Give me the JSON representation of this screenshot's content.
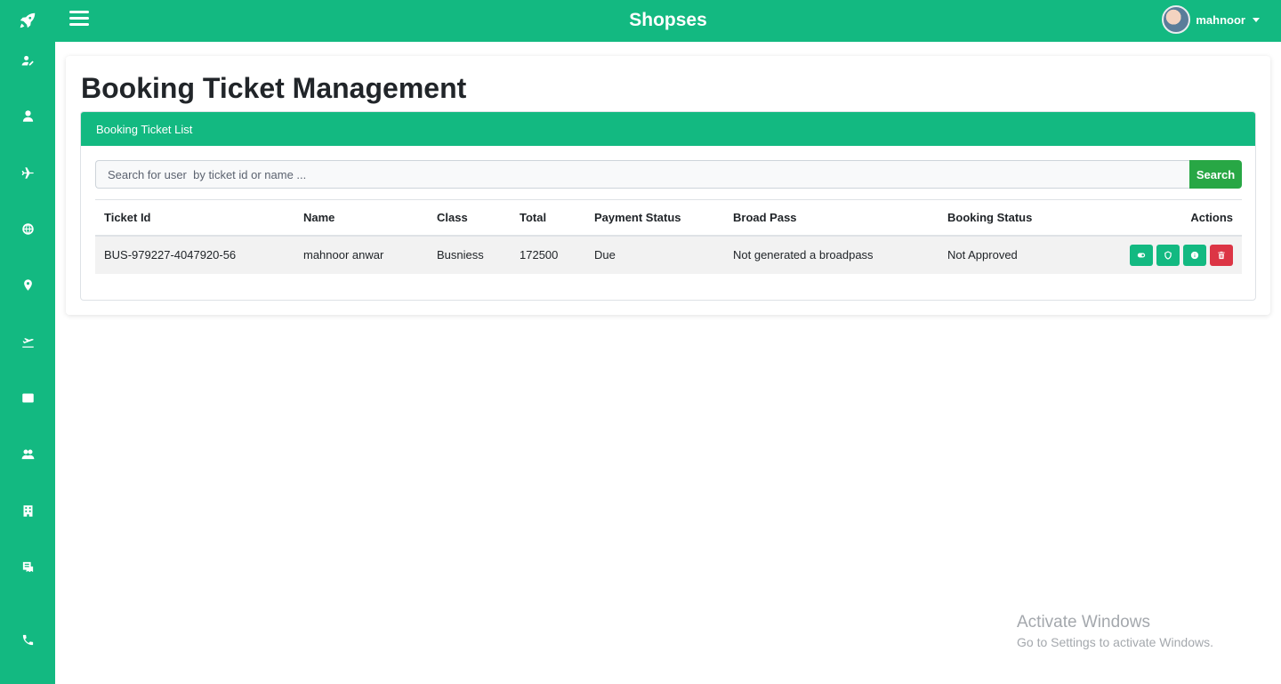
{
  "app": {
    "brand": "Shopses",
    "user_name": "mahnoor"
  },
  "sidebar": {
    "items": [
      {
        "icon": "user-edit-icon"
      },
      {
        "icon": "user-icon"
      },
      {
        "icon": "plane-icon"
      },
      {
        "icon": "globe-icon"
      },
      {
        "icon": "location-pin-icon"
      },
      {
        "icon": "plane-departure-icon"
      },
      {
        "icon": "envelope-icon"
      },
      {
        "icon": "users-icon"
      },
      {
        "icon": "building-icon"
      },
      {
        "icon": "receipt-icon"
      },
      {
        "icon": "phone-icon"
      }
    ]
  },
  "page": {
    "title": "Booking Ticket Management",
    "card_header": "Booking Ticket List"
  },
  "search": {
    "placeholder": "Search for user  by ticket id or name ...",
    "button_label": "Search"
  },
  "table": {
    "headers": [
      "Ticket Id",
      "Name",
      "Class",
      "Total",
      "Payment Status",
      "Broad Pass",
      "Booking Status",
      "Actions"
    ],
    "rows": [
      {
        "ticket_id": "BUS-979227-4047920-56",
        "name": "mahnoor anwar",
        "class": "Busniess",
        "total": "172500",
        "payment_status": "Due",
        "broad_pass": "Not generated a broadpass",
        "booking_status": "Not Approved"
      }
    ]
  },
  "watermark": {
    "title": "Activate Windows",
    "subtitle": "Go to Settings to activate Windows."
  },
  "colors": {
    "primary": "#13b981",
    "search_button": "#28a745",
    "danger": "#dc3545"
  }
}
